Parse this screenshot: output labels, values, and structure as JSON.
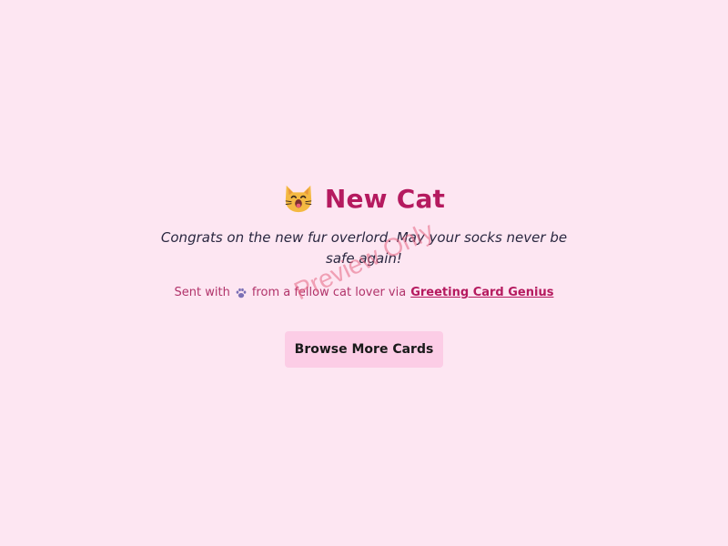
{
  "card": {
    "title": "New Cat",
    "title_icon": "cat-face-icon",
    "message": "Congrats on the new fur overlord. May your socks never be safe again!",
    "signature": {
      "prefix": "Sent with",
      "icon": "paw-print-icon",
      "middle": "from a fellow cat lover via",
      "link_label": "Greeting Card Genius"
    },
    "button_label": "Browse More Cards"
  },
  "watermark": "Preview Only",
  "colors": {
    "background": "#fde6f2",
    "title": "#b51a5f",
    "button": "#fccde6",
    "message": "#2a2740"
  }
}
